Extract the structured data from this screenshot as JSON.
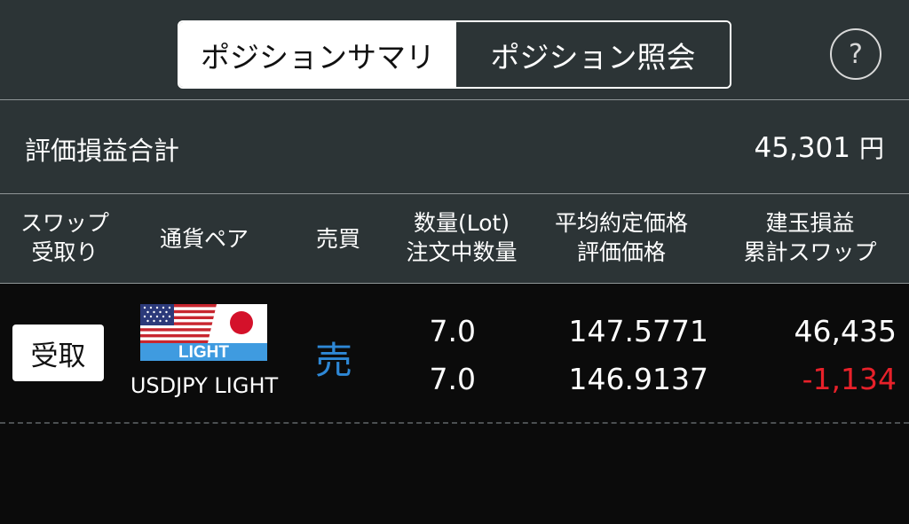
{
  "tabs": {
    "summary": "ポジションサマリ",
    "inquiry": "ポジション照会"
  },
  "help": {
    "label": "?"
  },
  "summary": {
    "label": "評価損益合計",
    "value": "45,301",
    "unit": "円"
  },
  "columns": {
    "swap_line1": "スワップ",
    "swap_line2": "受取り",
    "pair": "通貨ペア",
    "side": "売買",
    "qty_line1": "数量(Lot)",
    "qty_line2": "注文中数量",
    "price_line1": "平均約定価格",
    "price_line2": "評価価格",
    "pl_line1": "建玉損益",
    "pl_line2": "累計スワップ"
  },
  "position": {
    "swap_button": "受取",
    "flag_text": "LIGHT",
    "pair": "USDJPY LIGHT",
    "side": "売",
    "quantity": "7.0",
    "order_quantity": "7.0",
    "avg_price": "147.5771",
    "eval_price": "146.9137",
    "pl": "46,435",
    "swap_total": "-1,134"
  },
  "colors": {
    "header_bg": "#2c3436",
    "body_bg": "#0b0b0b",
    "sell": "#2e88d6",
    "negative": "#e8212a"
  }
}
